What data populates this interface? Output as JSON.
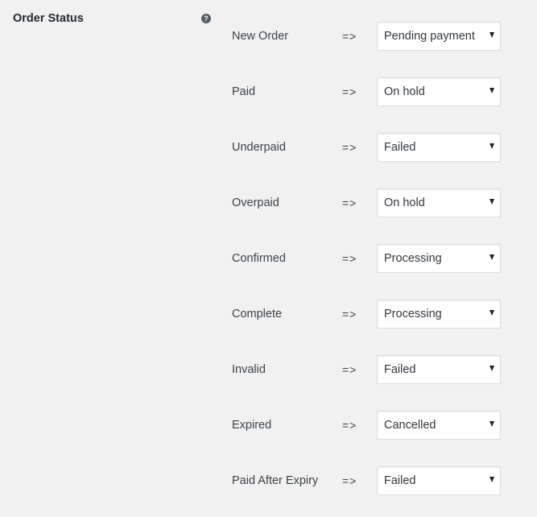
{
  "section": {
    "label": "Order Status",
    "help_icon": "question-mark-icon"
  },
  "mapping": {
    "arrow": "=>",
    "rows": [
      {
        "status": "New Order",
        "selected": "Pending payment"
      },
      {
        "status": "Paid",
        "selected": "On hold"
      },
      {
        "status": "Underpaid",
        "selected": "Failed"
      },
      {
        "status": "Overpaid",
        "selected": "On hold"
      },
      {
        "status": "Confirmed",
        "selected": "Processing"
      },
      {
        "status": "Complete",
        "selected": "Processing"
      },
      {
        "status": "Invalid",
        "selected": "Failed"
      },
      {
        "status": "Expired",
        "selected": "Cancelled"
      },
      {
        "status": "Paid After Expiry",
        "selected": "Failed"
      }
    ]
  }
}
